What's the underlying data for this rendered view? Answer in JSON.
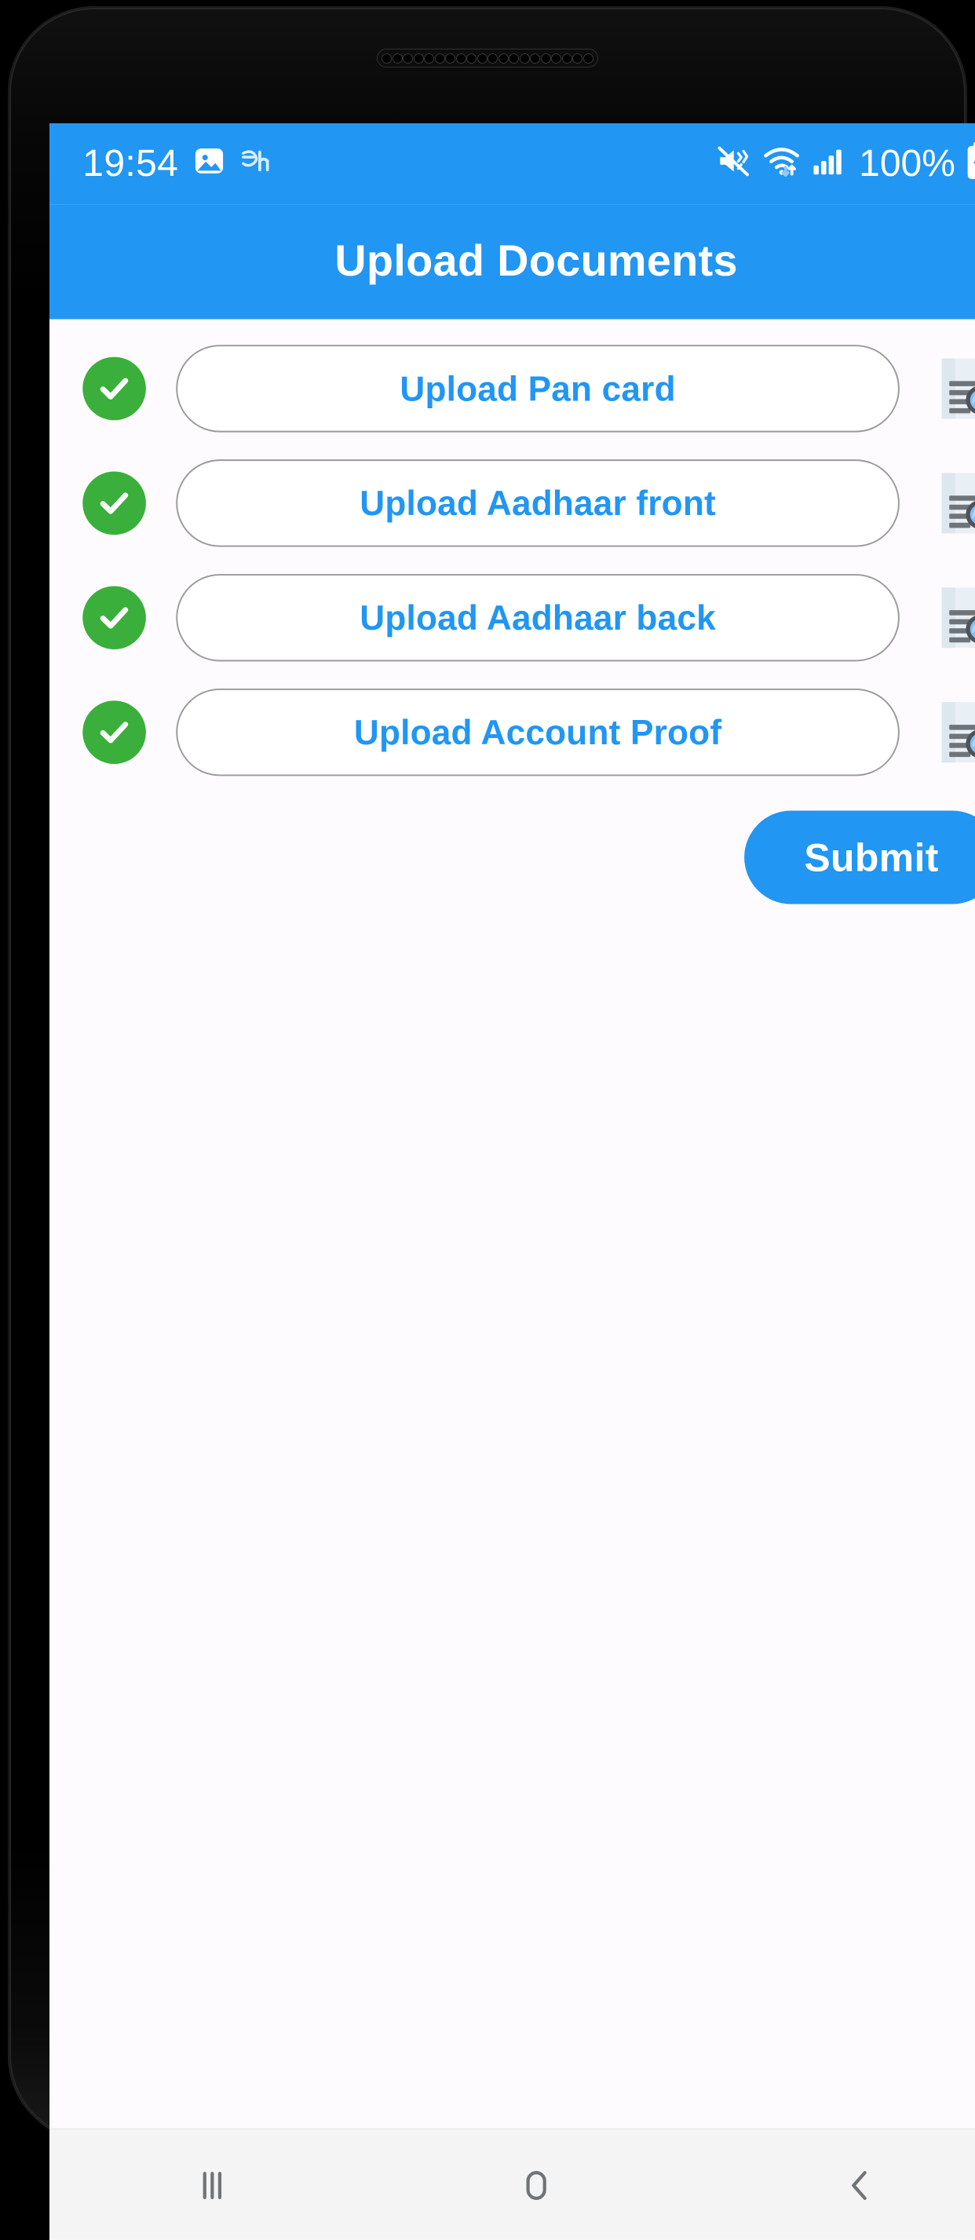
{
  "status_bar": {
    "time": "19:54",
    "icons_left": [
      "image-icon",
      "app-glyph-icon"
    ],
    "icons_right": [
      "mute-vibrate-icon",
      "wifi-icon",
      "signal-bars-icon"
    ],
    "battery_percent": "100%",
    "battery_state": "charging"
  },
  "app_bar": {
    "title": "Upload Documents"
  },
  "uploads": [
    {
      "label": "Upload Pan card",
      "status": "complete",
      "status_icon": "check-circle-icon",
      "doc_icon": "document-search-icon"
    },
    {
      "label": "Upload Aadhaar front",
      "status": "complete",
      "status_icon": "check-circle-icon",
      "doc_icon": "document-search-icon"
    },
    {
      "label": "Upload Aadhaar back",
      "status": "complete",
      "status_icon": "check-circle-icon",
      "doc_icon": "document-search-icon"
    },
    {
      "label": "Upload Account Proof",
      "status": "complete",
      "status_icon": "check-circle-icon",
      "doc_icon": "document-search-icon"
    }
  ],
  "actions": {
    "submit_label": "Submit"
  },
  "nav_bar": {
    "recents_icon": "recents-icon",
    "home_icon": "home-icon",
    "back_icon": "back-chevron-icon"
  },
  "colors": {
    "accent_blue": "#2196F3",
    "status_green": "#3BAF3B",
    "screen_bg": "#FDFBFD",
    "nav_bg": "#F4F4F4",
    "button_border": "#9A9A9A"
  }
}
